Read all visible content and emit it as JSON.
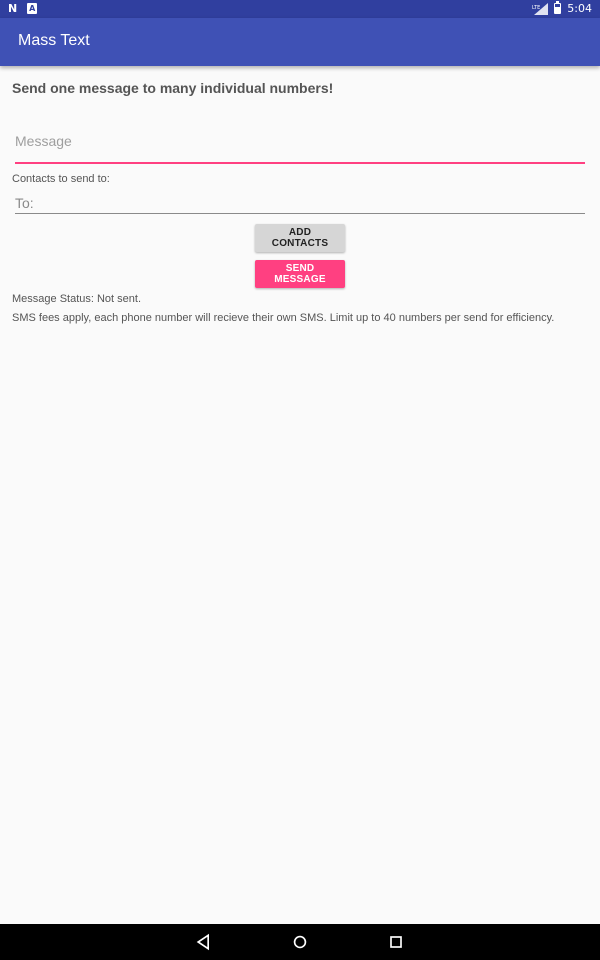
{
  "status_bar": {
    "time": "5:04",
    "left_icons": [
      "n-notification-icon",
      "a-notification-icon"
    ],
    "network_label": "LTE"
  },
  "app_bar": {
    "title": "Mass Text"
  },
  "main": {
    "headline": "Send one message to many individual numbers!",
    "message_placeholder": "Message",
    "contacts_label": "Contacts to send to:",
    "to_placeholder": "To:",
    "add_contacts_label": "ADD CONTACTS",
    "send_message_label": "SEND MESSAGE",
    "status_text": "Message Status: Not sent.",
    "fees_text": "SMS fees apply, each phone number will recieve their own SMS.  Limit up to 40 numbers per send for efficiency."
  },
  "colors": {
    "status_bar": "#303f9f",
    "app_bar": "#3f51b5",
    "accent": "#ff4081",
    "background": "#fafafa"
  },
  "nav_bar": {
    "icons": [
      "back-icon",
      "home-icon",
      "recents-icon"
    ]
  }
}
